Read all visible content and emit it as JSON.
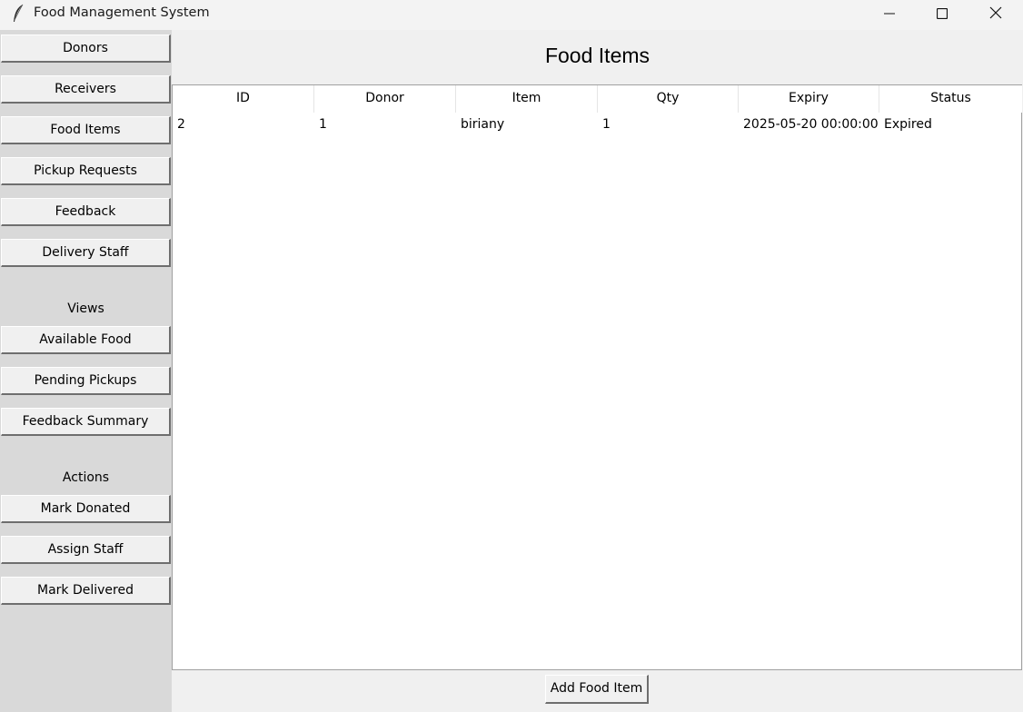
{
  "window": {
    "title": "Food Management System",
    "app_icon": "feather-icon",
    "controls": [
      "minimize-icon",
      "maximize-icon",
      "close-icon"
    ]
  },
  "sidebar": {
    "tables": [
      "Donors",
      "Receivers",
      "Food Items",
      "Pickup Requests",
      "Feedback",
      "Delivery Staff"
    ],
    "views_label": "Views",
    "views": [
      "Available Food",
      "Pending Pickups",
      "Feedback Summary"
    ],
    "actions_label": "Actions",
    "actions": [
      "Mark Donated",
      "Assign Staff",
      "Mark Delivered"
    ]
  },
  "main": {
    "title": "Food Items",
    "columns": [
      "ID",
      "Donor",
      "Item",
      "Qty",
      "Expiry",
      "Status"
    ],
    "rows": [
      [
        "2",
        "1",
        "biriany",
        "1",
        "2025-05-20 00:00:00",
        "Expired"
      ]
    ],
    "add_button": "Add Food Item"
  }
}
